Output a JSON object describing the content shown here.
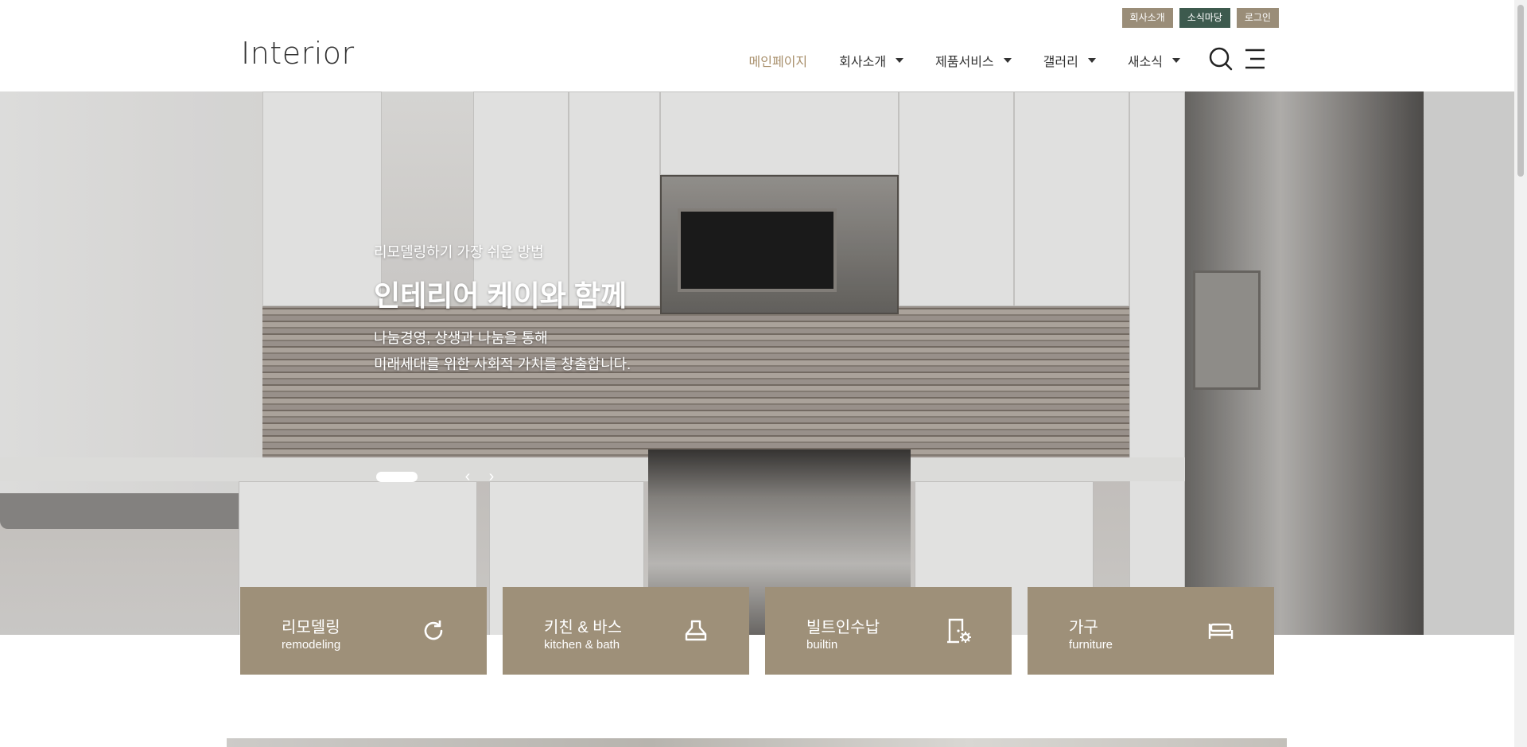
{
  "utility": {
    "company_label": "회사소개",
    "news_label": "소식마당",
    "login_label": "로그인"
  },
  "header": {
    "logo": "Interior",
    "nav": [
      {
        "label": "메인페이지",
        "active": true
      },
      {
        "label": "회사소개"
      },
      {
        "label": "제품서비스"
      },
      {
        "label": "갤러리"
      },
      {
        "label": "새소식"
      }
    ]
  },
  "hero": {
    "subtitle": "리모델링하기 가장 쉬운 방법",
    "title": "인테리어 케이와 함께",
    "desc_line1": "나눔경영, 상생과 나눔을 통해",
    "desc_line2": "미래세대를 위한 사회적 가치를 창출합니다.",
    "prev_arrow": "‹",
    "next_arrow": "›"
  },
  "cards": [
    {
      "kr": "리모델링",
      "en": "remodeling",
      "icon": "refresh-icon"
    },
    {
      "kr": "키친 & 바스",
      "en": "kitchen & bath",
      "icon": "range-hood-icon"
    },
    {
      "kr": "빌트인수납",
      "en": "builtin",
      "icon": "door-gear-icon"
    },
    {
      "kr": "가구",
      "en": "furniture",
      "icon": "bed-icon"
    }
  ],
  "colors": {
    "card_bg": "#9e9079",
    "util_brown": "#9a8d78",
    "util_green": "#3d5a4e",
    "nav_active": "#a88f6b"
  }
}
